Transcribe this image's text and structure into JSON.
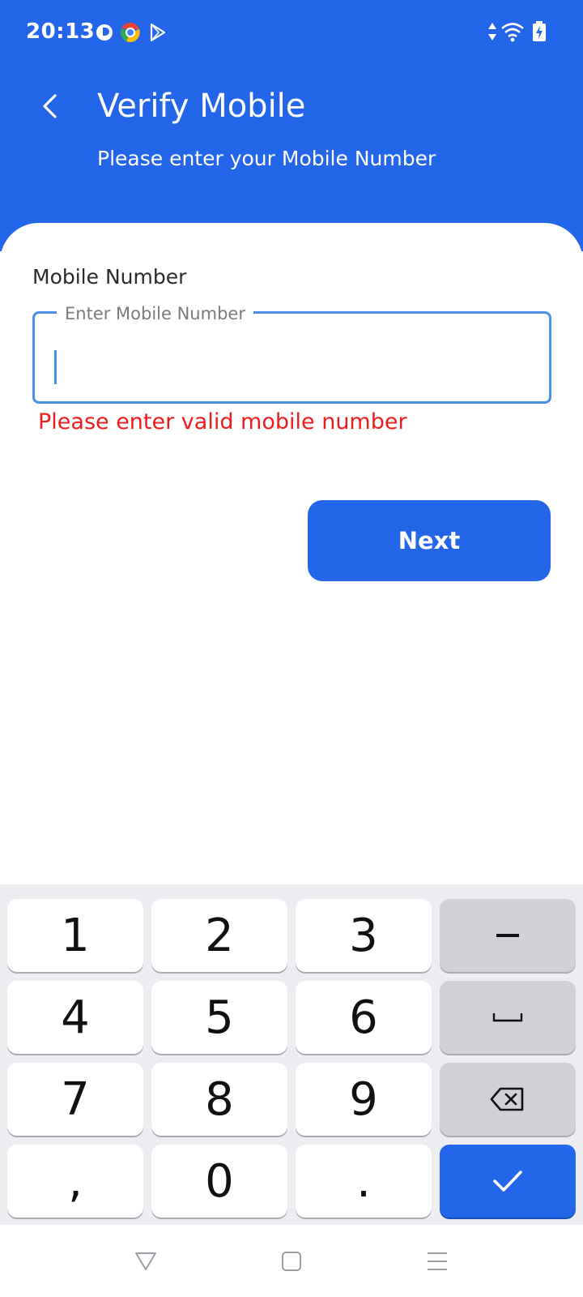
{
  "status_bar": {
    "time": "20:13",
    "left_icons": [
      "notification-app-icon",
      "chrome-like-icon",
      "play-store-icon"
    ],
    "right_icons": [
      "data-arrows-icon",
      "wifi-icon",
      "battery-charging-icon"
    ]
  },
  "header": {
    "title": "Verify Mobile",
    "subtitle": "Please enter your Mobile Number",
    "back_icon": "chevron-left-icon"
  },
  "form": {
    "field_label": "Mobile Number",
    "input_placeholder": "Enter Mobile Number",
    "input_value": "",
    "error_message": "Please enter valid mobile number",
    "next_button_label": "Next"
  },
  "keyboard": {
    "rows": [
      [
        "1",
        "2",
        "3",
        "−"
      ],
      [
        "4",
        "5",
        "6",
        "␣"
      ],
      [
        "7",
        "8",
        "9",
        "⌫"
      ],
      [
        ",",
        "0",
        ".",
        "✓"
      ]
    ]
  },
  "navigation_bar": {
    "buttons": [
      "back-triangle-icon",
      "home-square-icon",
      "recents-menu-icon"
    ]
  },
  "colors": {
    "primary": "#2366ea",
    "error": "#ee1c1c",
    "input_border": "#4a8fe8",
    "keyboard_bg": "#eceef2",
    "function_key": "#cfd1d7"
  }
}
